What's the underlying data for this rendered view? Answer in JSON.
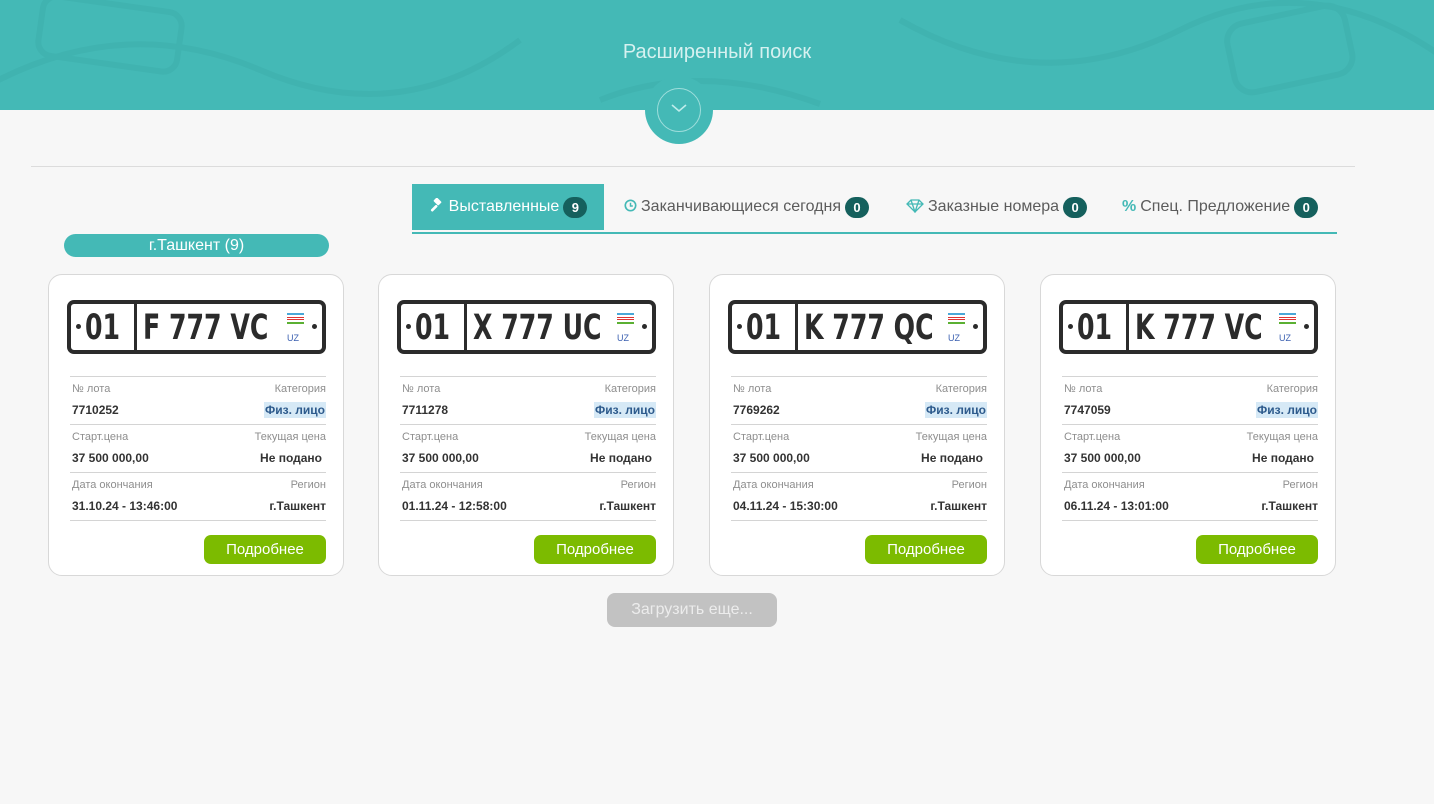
{
  "header": {
    "title": "Расширенный поиск"
  },
  "tabs": [
    {
      "label": "Выставленные",
      "count": "9",
      "icon": "gavel-icon",
      "active": true
    },
    {
      "label": "Заканчивающиеся сегодня",
      "count": "0",
      "icon": "clock-icon",
      "active": false
    },
    {
      "label": "Заказные номера",
      "count": "0",
      "icon": "diamond-icon",
      "active": false
    },
    {
      "label": "Спец. Предложение",
      "count": "0",
      "icon": "percent-icon",
      "active": false
    }
  ],
  "city_filter": {
    "label": "г.Ташкент (9)"
  },
  "labels": {
    "lot": "№ лота",
    "category": "Категория",
    "start_price": "Старт.цена",
    "current_price": "Текущая цена",
    "end_date": "Дата окончания",
    "region": "Регион",
    "details_button": "Подробнее"
  },
  "lots": [
    {
      "plate_region": "01",
      "plate_number": "F 777 VC",
      "plate_country": "UZ",
      "lot_no": "7710252",
      "category": "Физ. лицо",
      "start_price": "37 500 000,00",
      "current_price": "Не подано",
      "end_date": "31.10.24 - 13:46:00",
      "region": "г.Ташкент"
    },
    {
      "plate_region": "01",
      "plate_number": "X 777 UC",
      "plate_country": "UZ",
      "lot_no": "7711278",
      "category": "Физ. лицо",
      "start_price": "37 500 000,00",
      "current_price": "Не подано",
      "end_date": "01.11.24 - 12:58:00",
      "region": "г.Ташкент"
    },
    {
      "plate_region": "01",
      "plate_number": "K 777 QC",
      "plate_country": "UZ",
      "lot_no": "7769262",
      "category": "Физ. лицо",
      "start_price": "37 500 000,00",
      "current_price": "Не подано",
      "end_date": "04.11.24 - 15:30:00",
      "region": "г.Ташкент"
    },
    {
      "plate_region": "01",
      "plate_number": "K 777 VC",
      "plate_country": "UZ",
      "lot_no": "7747059",
      "category": "Физ. лицо",
      "start_price": "37 500 000,00",
      "current_price": "Не подано",
      "end_date": "06.11.24 - 13:01:00",
      "region": "г.Ташкент"
    }
  ],
  "load_more": {
    "label": "Загрузить еще..."
  },
  "colors": {
    "teal": "#44b9b6",
    "badge": "#15605d",
    "green": "#7cbb00",
    "flag_blue": "#4aa8d8",
    "flag_green": "#5bb033"
  }
}
